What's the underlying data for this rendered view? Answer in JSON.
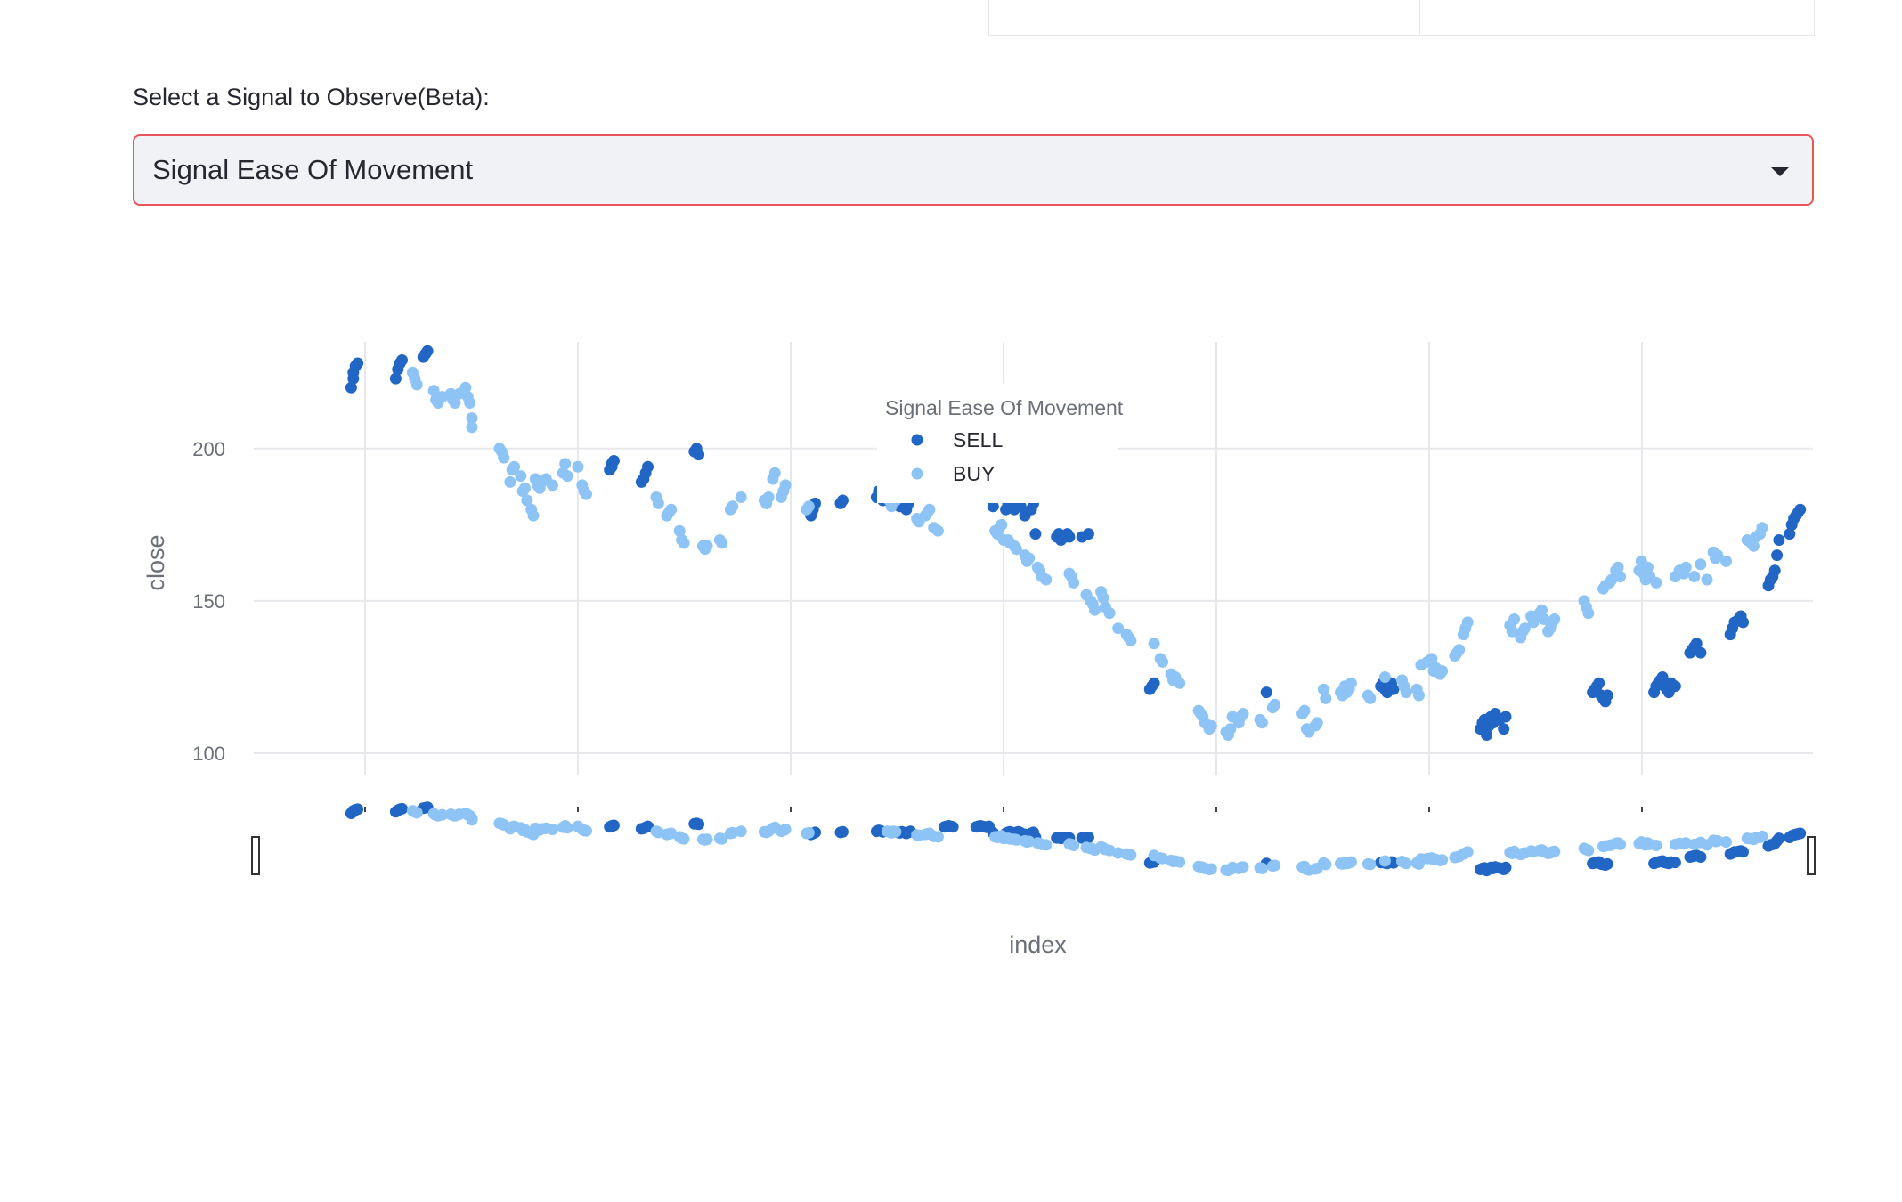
{
  "selector": {
    "label": "Select a Signal to Observe(Beta):",
    "value": "Signal Ease Of Movement"
  },
  "colors": {
    "sell": "#2166c4",
    "buy": "#8dc4f5",
    "grid": "#e8e8ec",
    "focus_border": "#e8565a"
  },
  "chart_data": {
    "type": "scatter",
    "xlabel": "index",
    "ylabel": "close",
    "ylim": [
      93,
      235
    ],
    "xlim": [
      -5,
      731
    ],
    "yticks": [
      100,
      150,
      200
    ],
    "grid": true,
    "legend": {
      "title": "Signal Ease Of Movement",
      "placement": "top-center"
    },
    "range_slider": true,
    "series": [
      {
        "name": "SELL",
        "color": "#2166c4",
        "x": [
          41,
          42,
          42,
          43,
          44,
          62,
          63,
          64,
          65,
          75,
          76,
          77,
          163,
          164,
          165,
          164,
          178,
          179,
          180,
          181,
          203,
          204,
          205,
          258,
          259,
          260,
          272,
          273,
          289,
          290,
          291,
          292,
          299,
          300,
          301,
          303,
          304,
          305,
          321,
          322,
          323,
          324,
          325,
          336,
          337,
          338,
          339,
          340,
          341,
          342,
          344,
          350,
          351,
          352,
          353,
          354,
          355,
          356,
          357,
          359,
          362,
          363,
          364,
          374,
          375,
          376,
          377,
          378,
          379,
          380,
          386,
          389,
          418,
          419,
          420,
          473,
          527,
          528,
          529,
          530,
          531,
          532,
          533,
          574,
          575,
          576,
          577,
          578,
          579,
          580,
          581,
          583,
          585,
          586,
          627,
          628,
          629,
          630,
          631,
          632,
          633,
          634,
          656,
          657,
          658,
          659,
          660,
          661,
          662,
          663,
          664,
          666,
          673,
          674,
          675,
          676,
          678,
          692,
          693,
          694,
          696,
          697,
          698,
          710,
          711,
          712,
          713,
          714,
          715,
          720,
          721,
          722,
          723,
          724,
          725
        ],
        "y": [
          220,
          223,
          225,
          227,
          228,
          223,
          226,
          228,
          229,
          230,
          231,
          232,
          193,
          194,
          196,
          195,
          189,
          190,
          192,
          194,
          199,
          200,
          198,
          178,
          180,
          182,
          182,
          183,
          184,
          186,
          185,
          183,
          182,
          181,
          183,
          180,
          182,
          184,
          193,
          194,
          195,
          194,
          193,
          193,
          194,
          195,
          194,
          193,
          192,
          194,
          181,
          180,
          182,
          183,
          181,
          180,
          182,
          183,
          181,
          178,
          180,
          182,
          172,
          171,
          172,
          170,
          171,
          171,
          172,
          171,
          171,
          172,
          121,
          122,
          123,
          120,
          122,
          123,
          121,
          120,
          122,
          123,
          121,
          108,
          110,
          111,
          106,
          109,
          112,
          110,
          113,
          111,
          108,
          112,
          120,
          121,
          122,
          123,
          119,
          118,
          117,
          119,
          120,
          122,
          123,
          124,
          125,
          122,
          121,
          120,
          123,
          122,
          133,
          134,
          135,
          136,
          133,
          139,
          141,
          143,
          144,
          145,
          143,
          155,
          157,
          158,
          160,
          165,
          170,
          172,
          175,
          177,
          178,
          179,
          180
        ]
      },
      {
        "name": "BUY",
        "color": "#8dc4f5",
        "x": [
          70,
          71,
          72,
          80,
          81,
          82,
          84,
          88,
          89,
          90,
          92,
          95,
          96,
          97,
          98,
          98,
          111,
          112,
          113,
          116,
          117,
          118,
          121,
          122,
          123,
          124,
          126,
          127,
          128,
          129,
          130,
          131,
          133,
          136,
          141,
          142,
          143,
          148,
          150,
          151,
          152,
          185,
          186,
          190,
          191,
          192,
          196,
          197,
          198,
          207,
          208,
          209,
          215,
          216,
          220,
          221,
          225,
          236,
          237,
          238,
          240,
          241,
          244,
          245,
          246,
          256,
          257,
          294,
          295,
          296,
          297,
          298,
          308,
          309,
          312,
          313,
          314,
          316,
          318,
          345,
          346,
          347,
          348,
          349,
          351,
          352,
          354,
          355,
          359,
          360,
          361,
          365,
          366,
          367,
          369,
          380,
          381,
          382,
          388,
          390,
          391,
          392,
          395,
          396,
          397,
          399,
          403,
          407,
          408,
          409,
          420,
          423,
          424,
          428,
          429,
          430,
          432,
          441,
          442,
          443,
          444,
          446,
          447,
          454,
          455,
          456,
          457,
          460,
          461,
          462,
          470,
          471,
          476,
          477,
          490,
          491,
          492,
          493,
          496,
          497,
          500,
          501,
          508,
          509,
          510,
          511,
          512,
          513,
          521,
          522,
          529,
          537,
          538,
          539,
          544,
          545,
          546,
          549,
          551,
          552,
          553,
          555,
          556,
          562,
          563,
          564,
          566,
          567,
          568,
          588,
          589,
          590,
          593,
          594,
          595,
          598,
          599,
          602,
          603,
          604,
          606,
          607,
          608,
          609,
          623,
          624,
          625,
          632,
          633,
          635,
          636,
          638,
          639,
          640,
          649,
          650,
          651,
          652,
          653,
          654,
          657,
          666,
          668,
          670,
          671,
          675,
          678,
          681,
          684,
          685,
          686,
          690,
          700,
          702,
          703,
          704,
          706,
          707
        ],
        "y": [
          225,
          223,
          221,
          219,
          216,
          215,
          217,
          218,
          216,
          215,
          218,
          220,
          217,
          215,
          210,
          207,
          200,
          199,
          197,
          189,
          193,
          194,
          191,
          186,
          187,
          183,
          180,
          178,
          190,
          188,
          187,
          189,
          190,
          188,
          192,
          195,
          191,
          194,
          188,
          186,
          185,
          184,
          182,
          178,
          179,
          180,
          173,
          170,
          169,
          168,
          167,
          168,
          170,
          169,
          180,
          181,
          184,
          183,
          182,
          184,
          190,
          192,
          184,
          186,
          188,
          180,
          181,
          184,
          183,
          181,
          184,
          183,
          177,
          176,
          178,
          179,
          180,
          174,
          173,
          173,
          172,
          174,
          175,
          170,
          170,
          169,
          168,
          167,
          165,
          163,
          164,
          161,
          160,
          158,
          157,
          159,
          158,
          156,
          152,
          150,
          149,
          147,
          153,
          151,
          148,
          146,
          141,
          139,
          138,
          137,
          136,
          131,
          130,
          126,
          124,
          125,
          123,
          114,
          113,
          112,
          110,
          108,
          109,
          107,
          106,
          108,
          112,
          110,
          112,
          113,
          111,
          110,
          115,
          116,
          113,
          114,
          108,
          107,
          109,
          110,
          121,
          118,
          120,
          119,
          122,
          120,
          121,
          123,
          119,
          118,
          125,
          124,
          122,
          120,
          121,
          119,
          129,
          130,
          131,
          127,
          128,
          126,
          127,
          132,
          133,
          134,
          139,
          141,
          143,
          142,
          140,
          144,
          138,
          140,
          141,
          145,
          143,
          146,
          147,
          144,
          140,
          141,
          143,
          144,
          150,
          148,
          146,
          154,
          155,
          156,
          157,
          160,
          161,
          158,
          160,
          163,
          159,
          157,
          161,
          158,
          156,
          158,
          160,
          159,
          161,
          158,
          162,
          157,
          166,
          164,
          165,
          163,
          170,
          169,
          168,
          171,
          172,
          174
        ]
      }
    ]
  }
}
